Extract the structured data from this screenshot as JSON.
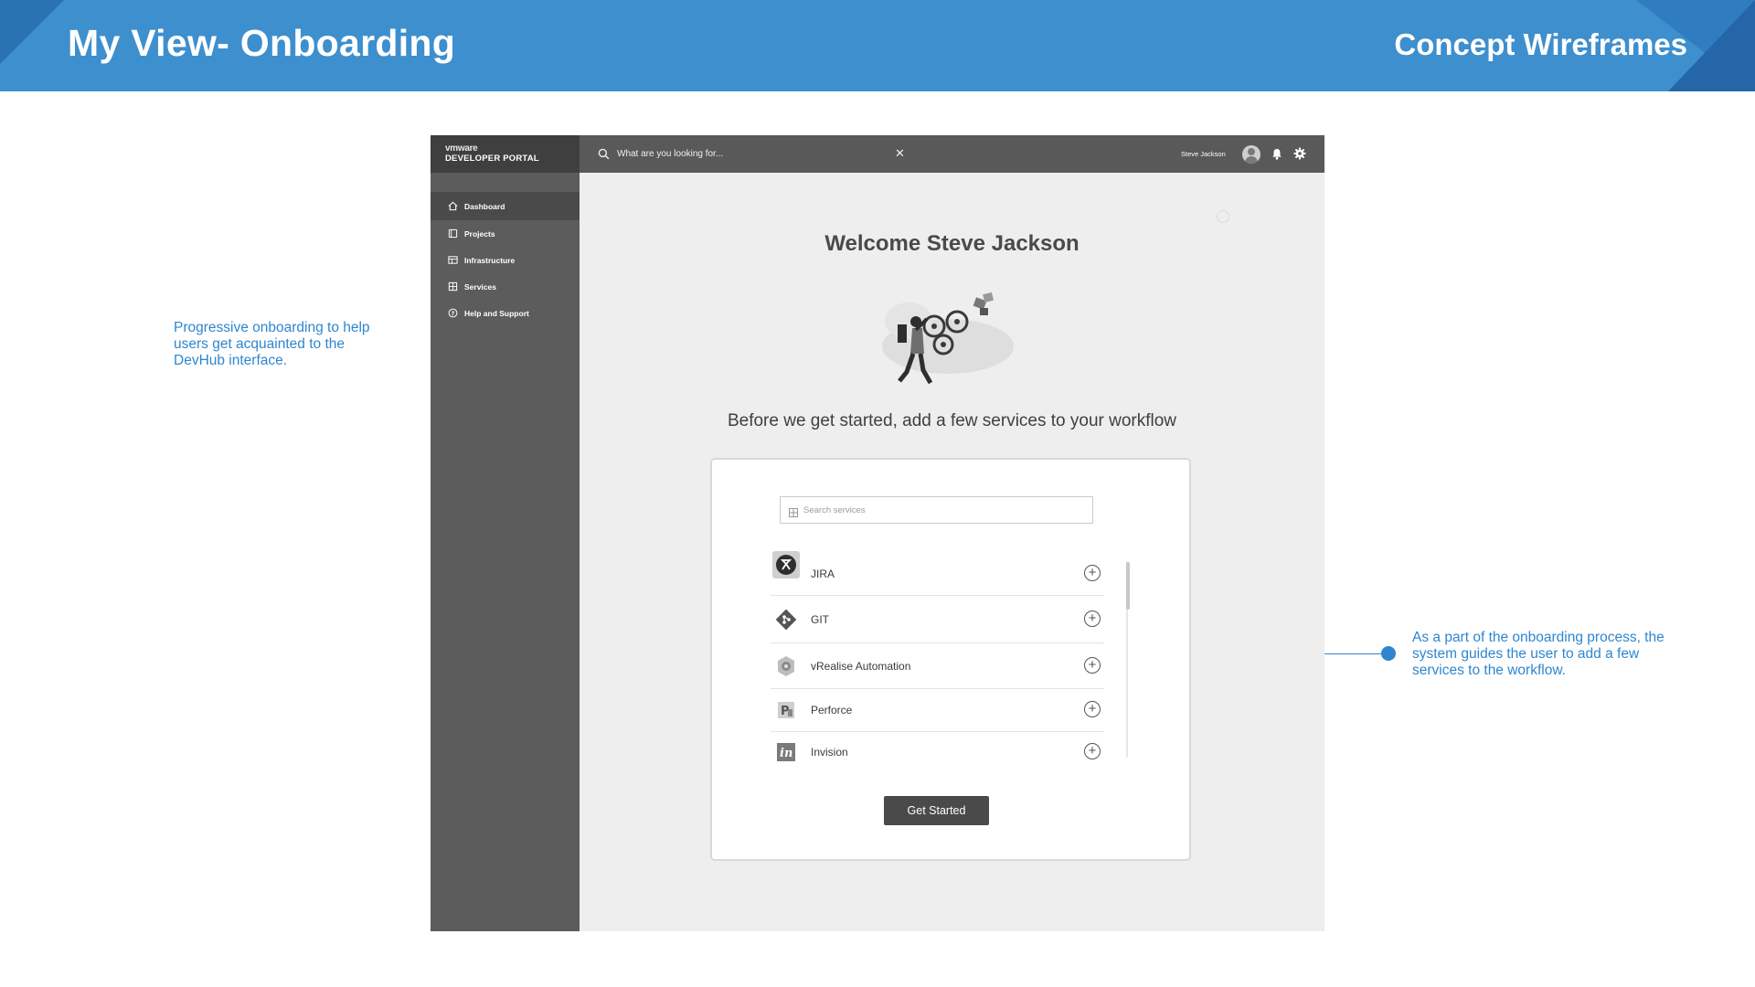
{
  "slide": {
    "title": "My View- Onboarding",
    "subtitle": "Concept Wireframes",
    "accent_color": "#3d8fce",
    "annotations": [
      {
        "text": "Progressive onboarding to help users get acquainted to the DevHub interface."
      },
      {
        "text": "As a part of the onboarding process, the system guides the user to add a few services to the workflow."
      }
    ]
  },
  "app": {
    "brand": {
      "vendor": "vmware",
      "name": "DEVELOPER PORTAL"
    },
    "search": {
      "placeholder": "What are you looking for..."
    },
    "user": {
      "name": "Steve Jackson"
    },
    "sidebar": {
      "items": [
        {
          "label": "Dashboard",
          "icon": "home-icon",
          "active": true
        },
        {
          "label": "Projects",
          "icon": "projects-icon"
        },
        {
          "label": "Infrastructure",
          "icon": "infrastructure-icon"
        },
        {
          "label": "Services",
          "icon": "services-icon"
        },
        {
          "label": "Help and Support",
          "icon": "help-icon"
        }
      ]
    },
    "main": {
      "welcome": "Welcome Steve Jackson",
      "prompt": "Before we get started, add a few services to your workflow",
      "service_search_placeholder": "Search services",
      "services": [
        {
          "name": "JIRA",
          "icon": "jira-logo-icon"
        },
        {
          "name": "GIT",
          "icon": "git-logo-icon"
        },
        {
          "name": "vRealise Automation",
          "icon": "vrealize-logo-icon"
        },
        {
          "name": "Perforce",
          "icon": "perforce-logo-icon"
        },
        {
          "name": "Invision",
          "icon": "invision-logo-icon"
        }
      ],
      "cta": "Get Started"
    }
  }
}
